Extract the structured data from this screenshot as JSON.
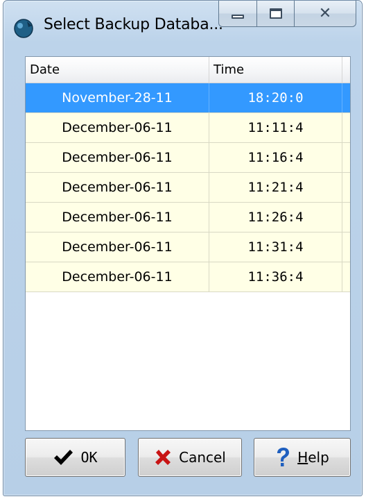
{
  "window": {
    "title": "Select Backup Databa..."
  },
  "titlebar": {
    "icon": "app-database-icon",
    "buttons": [
      "minimize-icon",
      "maximize-icon",
      "close-icon"
    ]
  },
  "grid": {
    "columns": [
      "Date",
      "Time"
    ],
    "rows": [
      {
        "date": "November-28-11",
        "time": "18:20:0",
        "selected": true
      },
      {
        "date": "December-06-11",
        "time": "11:11:4",
        "selected": false
      },
      {
        "date": "December-06-11",
        "time": "11:16:4",
        "selected": false
      },
      {
        "date": "December-06-11",
        "time": "11:21:4",
        "selected": false
      },
      {
        "date": "December-06-11",
        "time": "11:26:4",
        "selected": false
      },
      {
        "date": "December-06-11",
        "time": "11:31:4",
        "selected": false
      },
      {
        "date": "December-06-11",
        "time": "11:36:4",
        "selected": false
      }
    ],
    "colors": {
      "selected_row": "#3399ff",
      "row_background": "#ffffe6"
    }
  },
  "buttons": {
    "ok": {
      "label": "OK",
      "icon": "checkmark-icon"
    },
    "cancel": {
      "label": "Cancel",
      "icon": "x-icon"
    },
    "help": {
      "label": "Help",
      "hotkey_char": "H",
      "label_rest": "elp",
      "icon": "question-mark-icon"
    }
  }
}
